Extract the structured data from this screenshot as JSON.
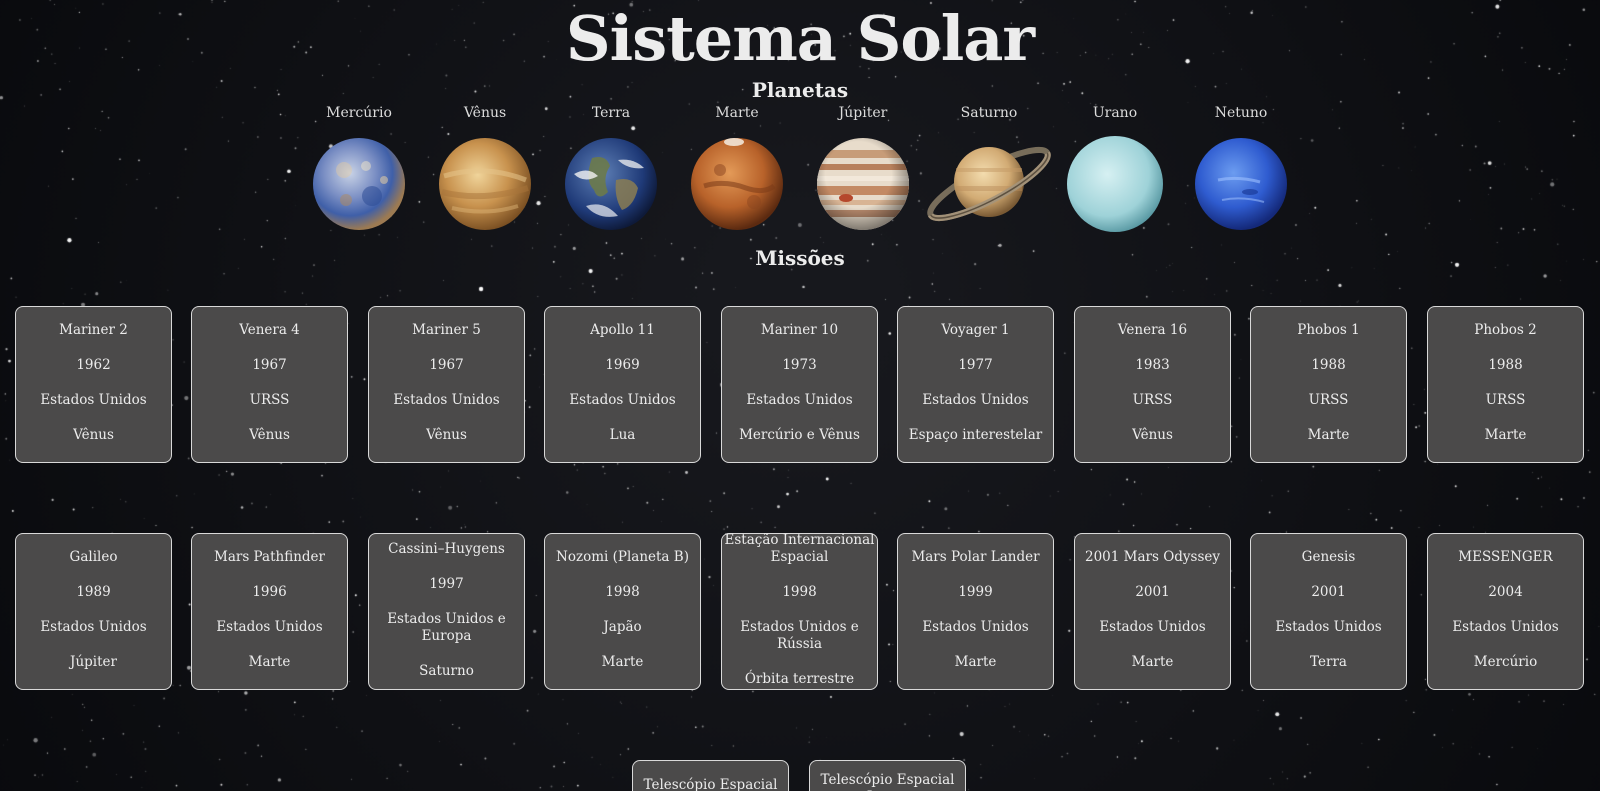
{
  "page": {
    "title": "Sistema Solar",
    "planets_heading": "Planetas",
    "missions_heading": "Missões"
  },
  "planets": [
    {
      "name": "Mercúrio",
      "icon": "mercury-planet"
    },
    {
      "name": "Vênus",
      "icon": "venus-planet"
    },
    {
      "name": "Terra",
      "icon": "earth-planet"
    },
    {
      "name": "Marte",
      "icon": "mars-planet"
    },
    {
      "name": "Júpiter",
      "icon": "jupiter-planet"
    },
    {
      "name": "Saturno",
      "icon": "saturn-planet"
    },
    {
      "name": "Urano",
      "icon": "uranus-planet"
    },
    {
      "name": "Netuno",
      "icon": "neptune-planet"
    }
  ],
  "missions_row1": [
    {
      "name": "Mariner 2",
      "year": "1962",
      "country": "Estados Unidos",
      "target": "Vênus"
    },
    {
      "name": "Venera 4",
      "year": "1967",
      "country": "URSS",
      "target": "Vênus"
    },
    {
      "name": "Mariner 5",
      "year": "1967",
      "country": "Estados Unidos",
      "target": "Vênus"
    },
    {
      "name": "Apollo 11",
      "year": "1969",
      "country": "Estados Unidos",
      "target": "Lua"
    },
    {
      "name": "Mariner 10",
      "year": "1973",
      "country": "Estados Unidos",
      "target": "Mercúrio e Vênus"
    },
    {
      "name": "Voyager 1",
      "year": "1977",
      "country": "Estados Unidos",
      "target": "Espaço interestelar"
    },
    {
      "name": "Venera 16",
      "year": "1983",
      "country": "URSS",
      "target": "Vênus"
    },
    {
      "name": "Phobos 1",
      "year": "1988",
      "country": "URSS",
      "target": "Marte"
    },
    {
      "name": "Phobos 2",
      "year": "1988",
      "country": "URSS",
      "target": "Marte"
    }
  ],
  "missions_row2": [
    {
      "name": "Galileo",
      "year": "1989",
      "country": "Estados Unidos",
      "target": "Júpiter"
    },
    {
      "name": "Mars Pathfinder",
      "year": "1996",
      "country": "Estados Unidos",
      "target": "Marte"
    },
    {
      "name": "Cassini–Huygens",
      "year": "1997",
      "country": "Estados Unidos e Europa",
      "target": "Saturno"
    },
    {
      "name": "Nozomi (Planeta B)",
      "year": "1998",
      "country": "Japão",
      "target": "Marte"
    },
    {
      "name": "Estação Internacional Espacial",
      "year": "1998",
      "country": "Estados Unidos e Rússia",
      "target": "Órbita terrestre"
    },
    {
      "name": "Mars Polar Lander",
      "year": "1999",
      "country": "Estados Unidos",
      "target": "Marte"
    },
    {
      "name": "2001 Mars Odyssey",
      "year": "2001",
      "country": "Estados Unidos",
      "target": "Marte"
    },
    {
      "name": "Genesis",
      "year": "2001",
      "country": "Estados Unidos",
      "target": "Terra"
    },
    {
      "name": "MESSENGER",
      "year": "2004",
      "country": "Estados Unidos",
      "target": "Mercúrio"
    }
  ],
  "missions_row3": [
    {
      "name": "Telescópio Espacial"
    },
    {
      "name": "Telescópio Espacial James"
    }
  ],
  "colors": {
    "card_bg": "#4b4a4a",
    "card_border": "#d9d9d9",
    "background": "#0d0e12",
    "text": "#ececec"
  }
}
